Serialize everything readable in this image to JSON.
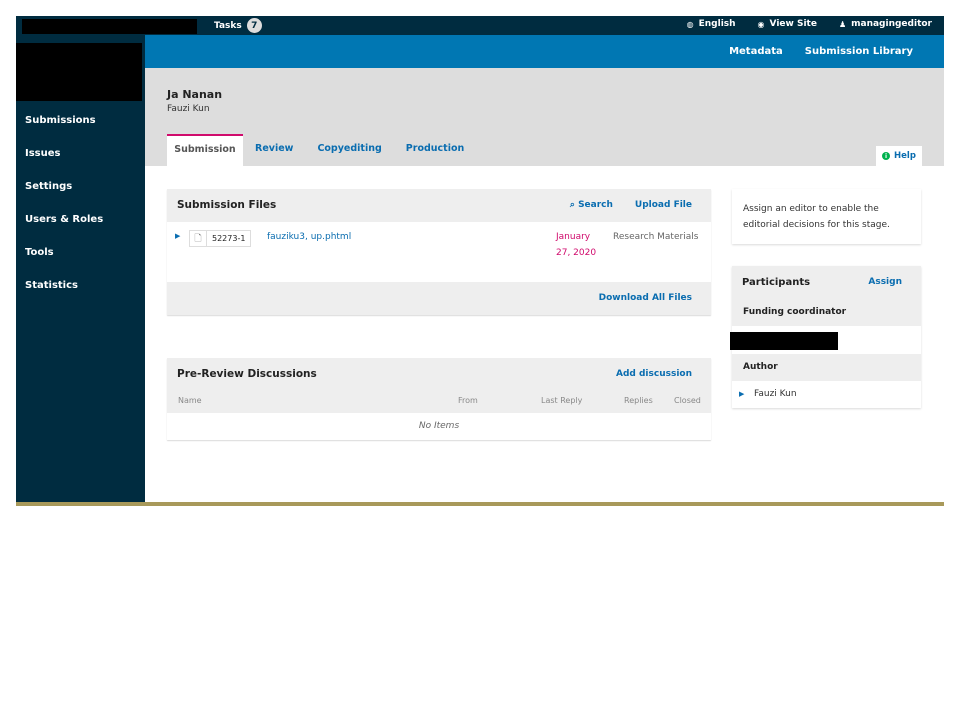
{
  "topbar": {
    "tasks_label": "Tasks",
    "tasks_count": "7",
    "language": "English",
    "view_site": "View Site",
    "username": "managingeditor",
    "icons": {
      "language": "globe-icon",
      "view_site": "eye-icon",
      "user": "user-icon"
    }
  },
  "sidebar": {
    "items": [
      {
        "label": "Submissions"
      },
      {
        "label": "Issues"
      },
      {
        "label": "Settings"
      },
      {
        "label": "Users & Roles"
      },
      {
        "label": "Tools"
      },
      {
        "label": "Statistics"
      }
    ]
  },
  "bluebar": {
    "metadata": "Metadata",
    "submission_library": "Submission Library"
  },
  "header": {
    "title": "Ja Nanan",
    "author": "Fauzi Kun",
    "tabs": [
      {
        "label": "Submission",
        "active": true
      },
      {
        "label": "Review"
      },
      {
        "label": "Copyediting"
      },
      {
        "label": "Production"
      }
    ],
    "help": "Help"
  },
  "submission_files": {
    "title": "Submission Files",
    "search": "Search",
    "upload": "Upload File",
    "files": [
      {
        "id": "52273-1",
        "name": "fauziku3, up.phtml",
        "date": "January 27, 2020",
        "type": "Research Materials"
      }
    ],
    "download_all": "Download All Files"
  },
  "discussions": {
    "title": "Pre-Review Discussions",
    "add": "Add discussion",
    "columns": [
      "Name",
      "From",
      "Last Reply",
      "Replies",
      "Closed"
    ],
    "empty": "No Items"
  },
  "editor_notice": "Assign an editor to enable the editorial decisions for this stage.",
  "participants": {
    "title": "Participants",
    "assign": "Assign",
    "roles": [
      {
        "role": "Funding coordinator",
        "members": [
          "[redacted]"
        ]
      },
      {
        "role": "Author",
        "members": [
          "Fauzi Kun"
        ]
      }
    ]
  },
  "colors": {
    "topbar": "#002c40",
    "brand_blue": "#0077b3",
    "link": "#0a6db0",
    "accent_pink": "#d00a6c",
    "help_green": "#00b24e"
  }
}
